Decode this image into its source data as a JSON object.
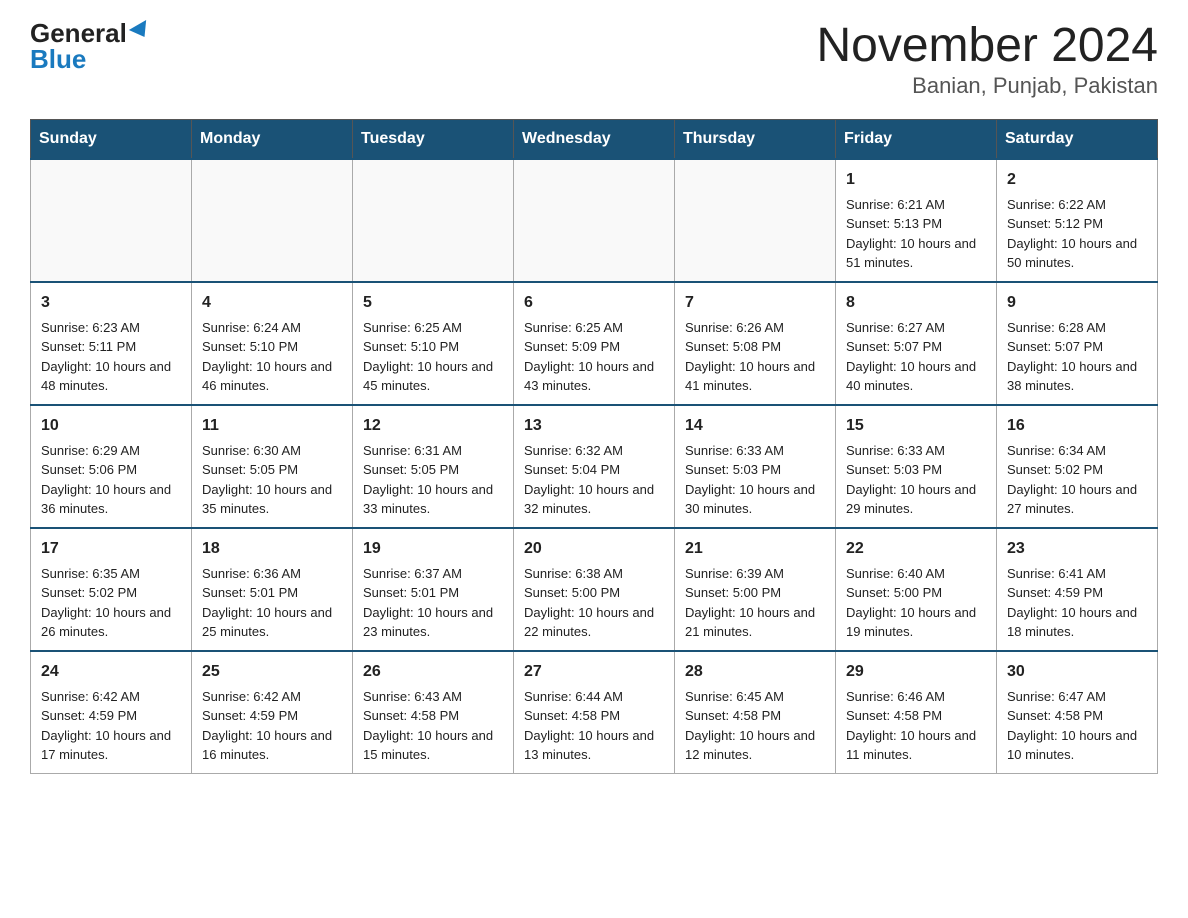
{
  "header": {
    "logo_general": "General",
    "logo_blue": "Blue",
    "month_title": "November 2024",
    "location": "Banian, Punjab, Pakistan"
  },
  "days_of_week": [
    "Sunday",
    "Monday",
    "Tuesday",
    "Wednesday",
    "Thursday",
    "Friday",
    "Saturday"
  ],
  "weeks": [
    [
      {
        "day": "",
        "info": ""
      },
      {
        "day": "",
        "info": ""
      },
      {
        "day": "",
        "info": ""
      },
      {
        "day": "",
        "info": ""
      },
      {
        "day": "",
        "info": ""
      },
      {
        "day": "1",
        "info": "Sunrise: 6:21 AM\nSunset: 5:13 PM\nDaylight: 10 hours and 51 minutes."
      },
      {
        "day": "2",
        "info": "Sunrise: 6:22 AM\nSunset: 5:12 PM\nDaylight: 10 hours and 50 minutes."
      }
    ],
    [
      {
        "day": "3",
        "info": "Sunrise: 6:23 AM\nSunset: 5:11 PM\nDaylight: 10 hours and 48 minutes."
      },
      {
        "day": "4",
        "info": "Sunrise: 6:24 AM\nSunset: 5:10 PM\nDaylight: 10 hours and 46 minutes."
      },
      {
        "day": "5",
        "info": "Sunrise: 6:25 AM\nSunset: 5:10 PM\nDaylight: 10 hours and 45 minutes."
      },
      {
        "day": "6",
        "info": "Sunrise: 6:25 AM\nSunset: 5:09 PM\nDaylight: 10 hours and 43 minutes."
      },
      {
        "day": "7",
        "info": "Sunrise: 6:26 AM\nSunset: 5:08 PM\nDaylight: 10 hours and 41 minutes."
      },
      {
        "day": "8",
        "info": "Sunrise: 6:27 AM\nSunset: 5:07 PM\nDaylight: 10 hours and 40 minutes."
      },
      {
        "day": "9",
        "info": "Sunrise: 6:28 AM\nSunset: 5:07 PM\nDaylight: 10 hours and 38 minutes."
      }
    ],
    [
      {
        "day": "10",
        "info": "Sunrise: 6:29 AM\nSunset: 5:06 PM\nDaylight: 10 hours and 36 minutes."
      },
      {
        "day": "11",
        "info": "Sunrise: 6:30 AM\nSunset: 5:05 PM\nDaylight: 10 hours and 35 minutes."
      },
      {
        "day": "12",
        "info": "Sunrise: 6:31 AM\nSunset: 5:05 PM\nDaylight: 10 hours and 33 minutes."
      },
      {
        "day": "13",
        "info": "Sunrise: 6:32 AM\nSunset: 5:04 PM\nDaylight: 10 hours and 32 minutes."
      },
      {
        "day": "14",
        "info": "Sunrise: 6:33 AM\nSunset: 5:03 PM\nDaylight: 10 hours and 30 minutes."
      },
      {
        "day": "15",
        "info": "Sunrise: 6:33 AM\nSunset: 5:03 PM\nDaylight: 10 hours and 29 minutes."
      },
      {
        "day": "16",
        "info": "Sunrise: 6:34 AM\nSunset: 5:02 PM\nDaylight: 10 hours and 27 minutes."
      }
    ],
    [
      {
        "day": "17",
        "info": "Sunrise: 6:35 AM\nSunset: 5:02 PM\nDaylight: 10 hours and 26 minutes."
      },
      {
        "day": "18",
        "info": "Sunrise: 6:36 AM\nSunset: 5:01 PM\nDaylight: 10 hours and 25 minutes."
      },
      {
        "day": "19",
        "info": "Sunrise: 6:37 AM\nSunset: 5:01 PM\nDaylight: 10 hours and 23 minutes."
      },
      {
        "day": "20",
        "info": "Sunrise: 6:38 AM\nSunset: 5:00 PM\nDaylight: 10 hours and 22 minutes."
      },
      {
        "day": "21",
        "info": "Sunrise: 6:39 AM\nSunset: 5:00 PM\nDaylight: 10 hours and 21 minutes."
      },
      {
        "day": "22",
        "info": "Sunrise: 6:40 AM\nSunset: 5:00 PM\nDaylight: 10 hours and 19 minutes."
      },
      {
        "day": "23",
        "info": "Sunrise: 6:41 AM\nSunset: 4:59 PM\nDaylight: 10 hours and 18 minutes."
      }
    ],
    [
      {
        "day": "24",
        "info": "Sunrise: 6:42 AM\nSunset: 4:59 PM\nDaylight: 10 hours and 17 minutes."
      },
      {
        "day": "25",
        "info": "Sunrise: 6:42 AM\nSunset: 4:59 PM\nDaylight: 10 hours and 16 minutes."
      },
      {
        "day": "26",
        "info": "Sunrise: 6:43 AM\nSunset: 4:58 PM\nDaylight: 10 hours and 15 minutes."
      },
      {
        "day": "27",
        "info": "Sunrise: 6:44 AM\nSunset: 4:58 PM\nDaylight: 10 hours and 13 minutes."
      },
      {
        "day": "28",
        "info": "Sunrise: 6:45 AM\nSunset: 4:58 PM\nDaylight: 10 hours and 12 minutes."
      },
      {
        "day": "29",
        "info": "Sunrise: 6:46 AM\nSunset: 4:58 PM\nDaylight: 10 hours and 11 minutes."
      },
      {
        "day": "30",
        "info": "Sunrise: 6:47 AM\nSunset: 4:58 PM\nDaylight: 10 hours and 10 minutes."
      }
    ]
  ]
}
